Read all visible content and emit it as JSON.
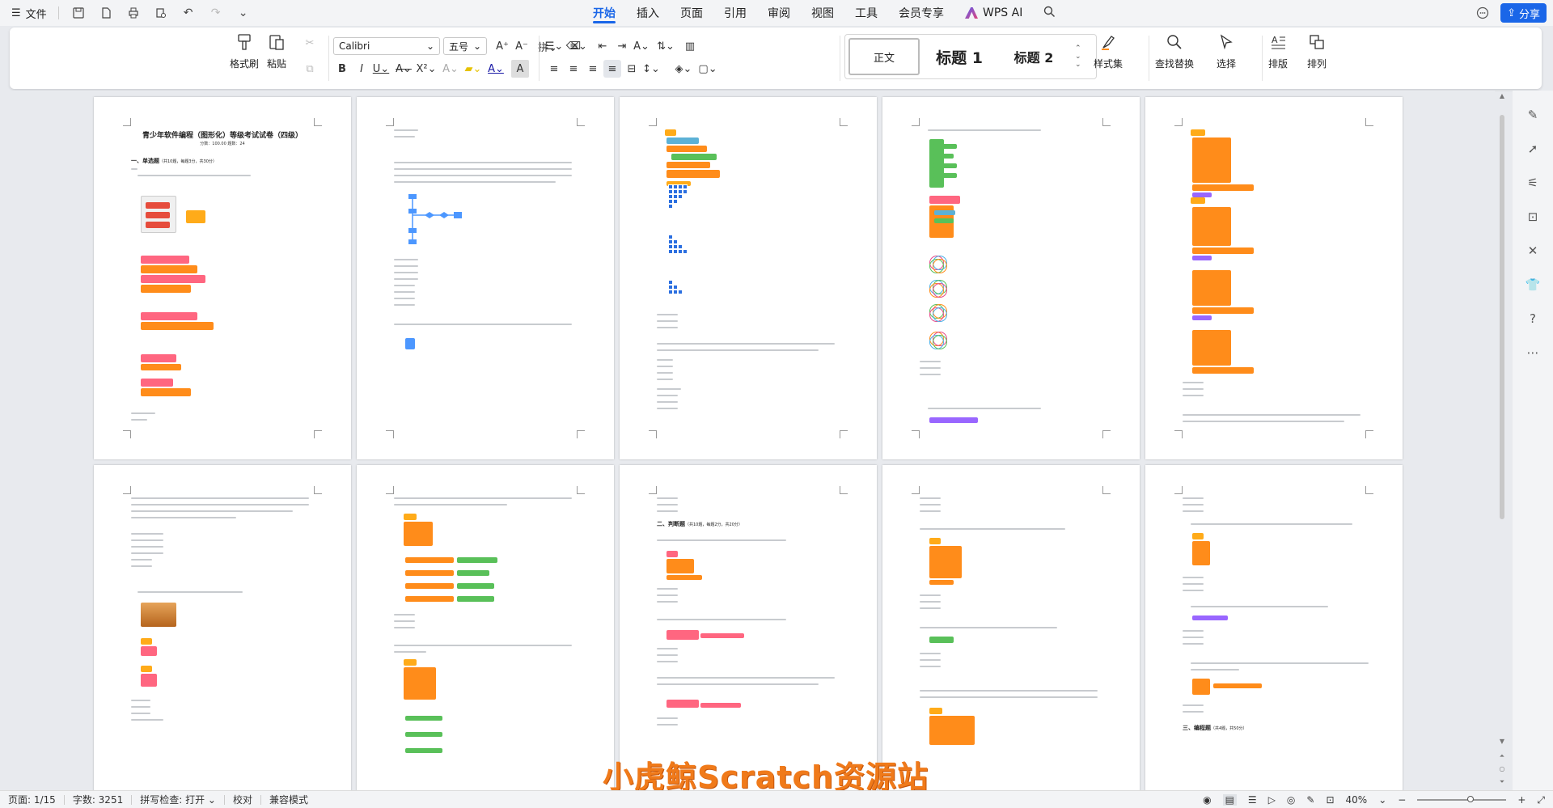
{
  "menubar": {
    "file_label": "文件",
    "tabs": [
      {
        "label": "开始",
        "active": true
      },
      {
        "label": "插入"
      },
      {
        "label": "页面"
      },
      {
        "label": "引用"
      },
      {
        "label": "审阅"
      },
      {
        "label": "视图"
      },
      {
        "label": "工具"
      },
      {
        "label": "会员专享"
      }
    ],
    "wps_ai_label": "WPS AI",
    "share_label": "分享"
  },
  "ribbon": {
    "format_painter": "格式刷",
    "paste": "粘贴",
    "font_name": "Calibri",
    "font_size": "五号",
    "style_normal": "正文",
    "style_h1": "标题 1",
    "style_h2": "标题 2",
    "style_set": "样式集",
    "find_replace": "查找替换",
    "select": "选择",
    "arrange": "排版",
    "sort": "排列"
  },
  "document": {
    "page1_title": "青少年软件编程（图形化）等级考试试卷（四级）",
    "page1_sub": "分数：100.00     题数：24",
    "page1_section": "一、单选题",
    "page1_section_note": "（共10题，每题3分，共30分）",
    "page8_section": "二、判断题",
    "page8_section_note": "（共10题，每题2分，共20分）",
    "page10_section": "三、编程题",
    "page10_section_note": "（共4题，共50分）"
  },
  "watermark": "小虎鲸Scratch资源站",
  "statusbar": {
    "page": "页面: 1/15",
    "words": "字数: 3251",
    "spellcheck": "拼写检查: 打开",
    "proofread": "校对",
    "compat": "兼容模式",
    "zoom": "40%",
    "zoom_fraction": 0.4
  },
  "colors": {
    "accent": "#1a66e8",
    "watermark": "#f07a1a"
  }
}
